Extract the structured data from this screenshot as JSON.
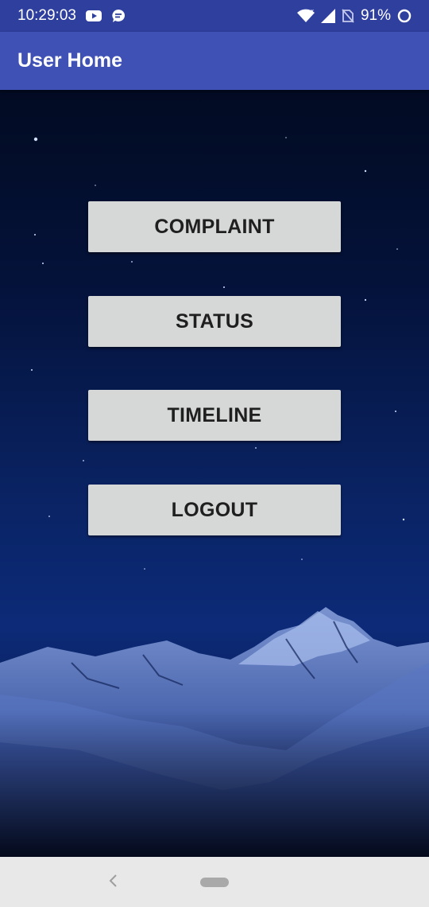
{
  "status_bar": {
    "time": "10:29:03",
    "battery_percent": "91%",
    "icons": [
      "youtube-icon",
      "messaging-icon",
      "wifi-icon",
      "signal-icon",
      "no-sim-icon",
      "battery-ring-icon"
    ]
  },
  "app_bar": {
    "title": "User Home"
  },
  "menu": {
    "complaint_label": "COMPLAINT",
    "status_label": "STATUS",
    "timeline_label": "TIMELINE",
    "logout_label": "LOGOUT"
  },
  "nav_bar": {
    "icons": [
      "back-icon",
      "home-pill-icon"
    ]
  },
  "colors": {
    "status_bar": "#2f3f9e",
    "app_bar": "#3f51b5",
    "button_bg": "#d6d7d7",
    "button_text": "#1f1f1f",
    "nav_bar": "#e8e8e8"
  }
}
